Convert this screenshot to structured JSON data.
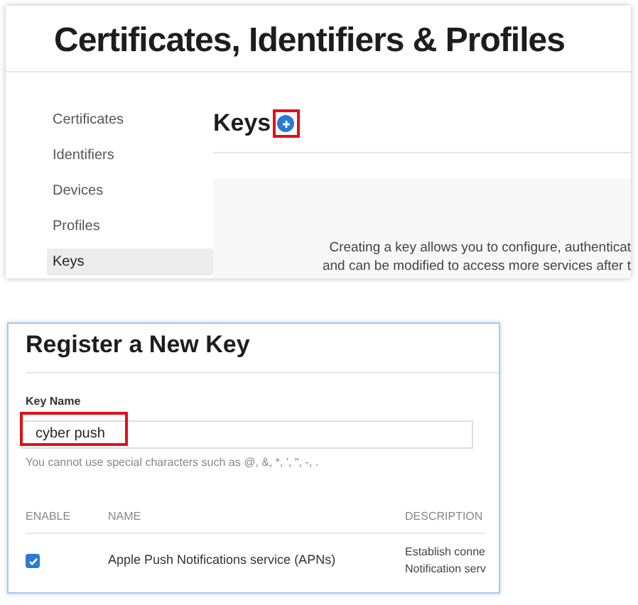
{
  "portal": {
    "title": "Certificates, Identifiers & Profiles",
    "sidebar": {
      "items": [
        {
          "label": "Certificates",
          "selected": false
        },
        {
          "label": "Identifiers",
          "selected": false
        },
        {
          "label": "Devices",
          "selected": false
        },
        {
          "label": "Profiles",
          "selected": false
        },
        {
          "label": "Keys",
          "selected": true
        }
      ]
    },
    "heading": "Keys",
    "add_highlighted": true,
    "empty_state": [
      "Creating a key allows you to configure, authenticat",
      "and can be modified to access more services after t"
    ]
  },
  "register": {
    "title": "Register a New Key",
    "field_label": "Key Name",
    "value": "cyber push",
    "value_highlighted": true,
    "hint": "You cannot use special characters such as @, &, *, ', \", -, .",
    "columns": [
      "ENABLE",
      "NAME",
      "DESCRIPTION"
    ],
    "rows": [
      {
        "checked": true,
        "name": "Apple Push Notifications service (APNs)",
        "description": [
          "Establish conne",
          "Notification serv"
        ]
      }
    ]
  }
}
